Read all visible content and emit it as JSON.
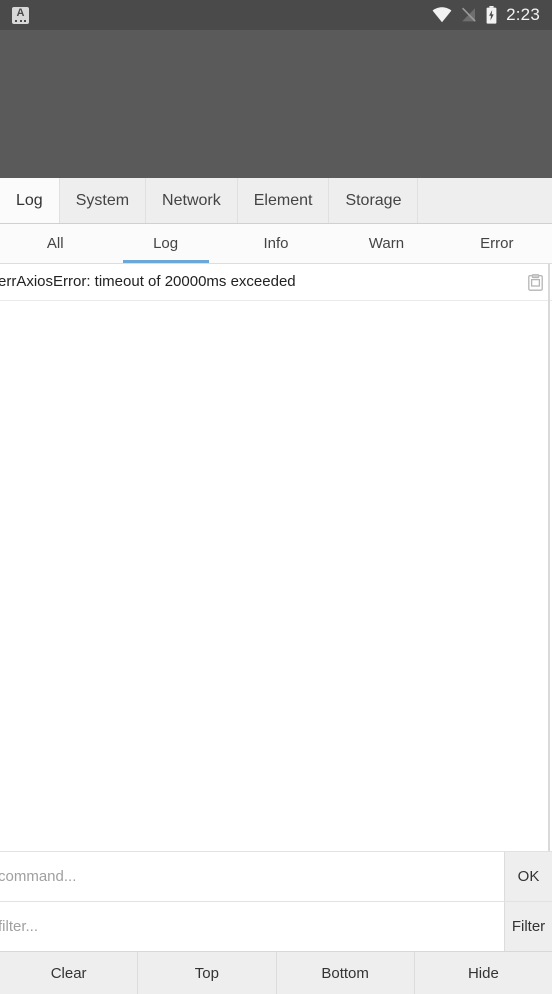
{
  "status_bar": {
    "ime_icon_letter": "A",
    "ime_icon_name": "ime-keyboard-icon",
    "wifi_icon_name": "wifi-icon",
    "signal_off_icon_name": "signal-no-sim-icon",
    "battery_icon_name": "battery-charging-icon",
    "clock": "2:23",
    "background": "#4a4a4a",
    "foreground": "#f2f2f2"
  },
  "app_content": {
    "background": "#5a5a5a"
  },
  "console": {
    "tabs": [
      {
        "label": "Log",
        "active": true
      },
      {
        "label": "System",
        "active": false
      },
      {
        "label": "Network",
        "active": false
      },
      {
        "label": "Element",
        "active": false
      },
      {
        "label": "Storage",
        "active": false
      }
    ],
    "subtabs": [
      {
        "label": "All",
        "active": false
      },
      {
        "label": "Log",
        "active": true
      },
      {
        "label": "Info",
        "active": false
      },
      {
        "label": "Warn",
        "active": false
      },
      {
        "label": "Error",
        "active": false
      }
    ],
    "active_indicator_color": "#6ba8d8",
    "log_entries": [
      {
        "text": "errAxiosError: timeout of 20000ms exceeded",
        "copy_icon_name": "copy-clipboard-icon"
      }
    ],
    "command_input": {
      "placeholder": "command...",
      "value": "",
      "button_label": "OK"
    },
    "filter_input": {
      "placeholder": "filter...",
      "value": "",
      "button_label": "Filter"
    },
    "bottom_actions": [
      {
        "label": "Clear"
      },
      {
        "label": "Top"
      },
      {
        "label": "Bottom"
      },
      {
        "label": "Hide"
      }
    ]
  }
}
